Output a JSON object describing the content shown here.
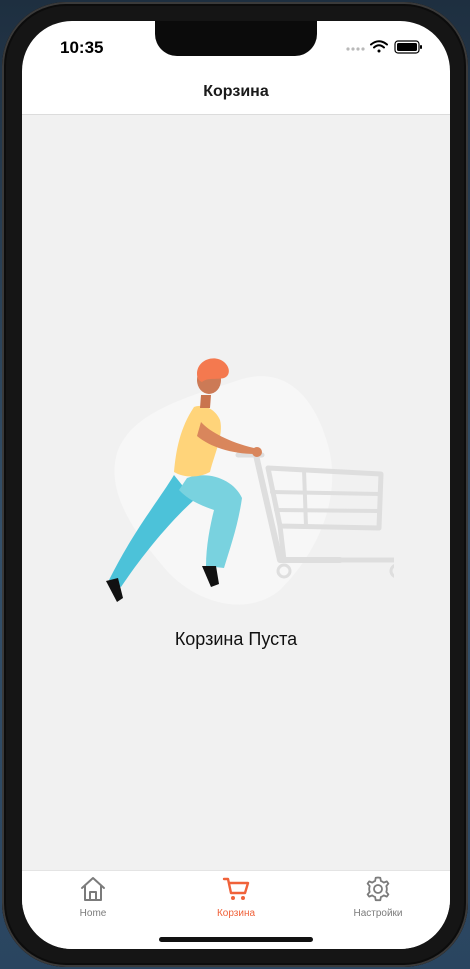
{
  "status_bar": {
    "time": "10:35"
  },
  "nav": {
    "title": "Корзина"
  },
  "empty_state": {
    "message": "Корзина Пуста"
  },
  "tabs": [
    {
      "label": "Home",
      "icon": "home-icon",
      "active": false
    },
    {
      "label": "Корзина",
      "icon": "cart-icon",
      "active": true
    },
    {
      "label": "Настройки",
      "icon": "gear-icon",
      "active": false
    }
  ],
  "colors": {
    "accent": "#f0623a",
    "inactive": "#7b7b7b",
    "content_background": "#f1f1f1"
  }
}
